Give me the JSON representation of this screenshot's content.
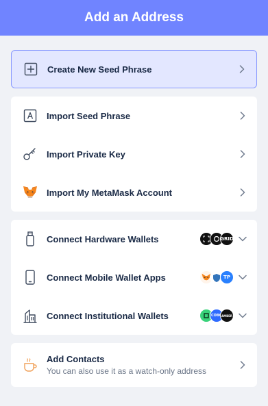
{
  "header": {
    "title": "Add an Address"
  },
  "create": {
    "label": "Create New Seed Phrase",
    "icon": "plus-square-icon"
  },
  "import_section": [
    {
      "label": "Import Seed Phrase",
      "icon": "letter-a-icon"
    },
    {
      "label": "Import Private Key",
      "icon": "key-icon"
    },
    {
      "label": "Import My MetaMask Account",
      "icon": "metamask-fox-icon"
    }
  ],
  "connect_section": [
    {
      "label": "Connect Hardware Wallets",
      "icon": "usb-device-icon",
      "badges": [
        {
          "name": "ledger-logo",
          "text": "",
          "color": "#111111"
        },
        {
          "name": "onekey-logo",
          "text": "",
          "color": "#111111"
        },
        {
          "name": "gridplus-logo",
          "text": "GRID",
          "color": "#111111"
        }
      ]
    },
    {
      "label": "Connect Mobile Wallet Apps",
      "icon": "smartphone-icon",
      "badges": [
        {
          "name": "metamask-logo",
          "text": "",
          "color": "#f6851b"
        },
        {
          "name": "trust-wallet-logo",
          "text": "",
          "color": "#3375bb"
        },
        {
          "name": "tokenpocket-logo",
          "text": "TP",
          "color": "#2980fe"
        }
      ]
    },
    {
      "label": "Connect Institutional Wallets",
      "icon": "buildings-icon",
      "badges": [
        {
          "name": "jade-logo",
          "text": "",
          "color": "#39d27a"
        },
        {
          "name": "cobo-logo",
          "text": "COBO",
          "color": "#2f6bff"
        },
        {
          "name": "amber-logo",
          "text": "AMBER",
          "color": "#111111"
        }
      ]
    }
  ],
  "contacts": {
    "label": "Add Contacts",
    "subtitle": "You can also use it as a watch-only address",
    "icon": "coffee-cup-icon"
  },
  "colors": {
    "header": "#7084ff",
    "highlight_bg": "#e3e7ff",
    "highlight_border": "#8697ff",
    "background": "#f0f2f6",
    "text": "#192945"
  }
}
